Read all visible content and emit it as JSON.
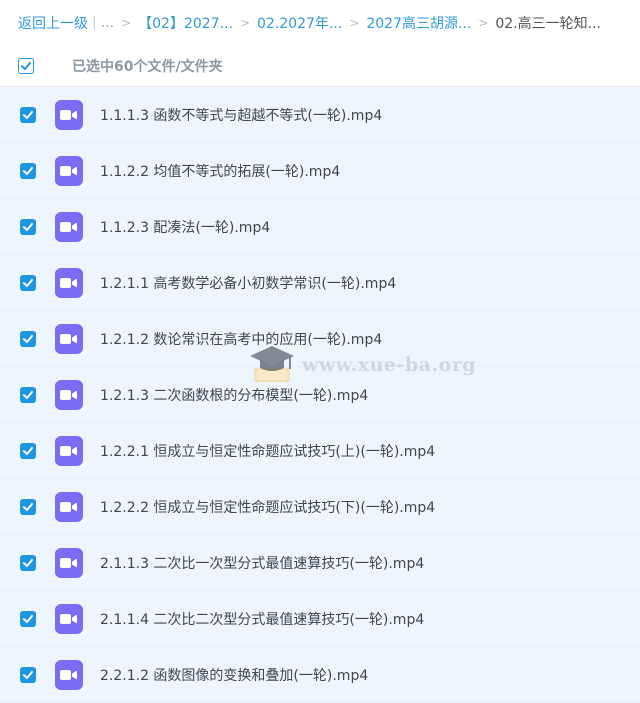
{
  "breadcrumb": {
    "back": "返回上一级",
    "ellipsis": "...",
    "crumbs": [
      "【02】2027...",
      "02.2027年...",
      "2027高三胡源..."
    ],
    "current": "02.高三一轮知..."
  },
  "selection": {
    "label": "已选中60个文件/文件夹"
  },
  "files": [
    "1.1.1.3 函数不等式与超越不等式(一轮).mp4",
    "1.1.2.2 均值不等式的拓展(一轮).mp4",
    "1.1.2.3 配凑法(一轮).mp4",
    "1.2.1.1 高考数学必备小初数学常识(一轮).mp4",
    "1.2.1.2 数论常识在高考中的应用(一轮).mp4",
    "1.2.1.3 二次函数根的分布模型(一轮).mp4",
    "1.2.2.1 恒成立与恒定性命题应试技巧(上)(一轮).mp4",
    "1.2.2.2 恒成立与恒定性命题应试技巧(下)(一轮).mp4",
    "2.1.1.3 二次比一次型分式最值速算技巧(一轮).mp4",
    "2.1.1.4 二次比二次型分式最值速算技巧(一轮).mp4",
    "2.2.1.2 函数图像的变换和叠加(一轮).mp4"
  ],
  "watermark": {
    "text": "www.xue-ba.org"
  },
  "colors": {
    "accent": "#1e97e0",
    "row_bg": "#eef6fd",
    "video_icon": "#7b6cf6",
    "link": "#2f9ad8"
  },
  "icons": {
    "checkbox": "check-icon",
    "file": "video-file-icon",
    "watermark": "graduation-cap-icon"
  }
}
